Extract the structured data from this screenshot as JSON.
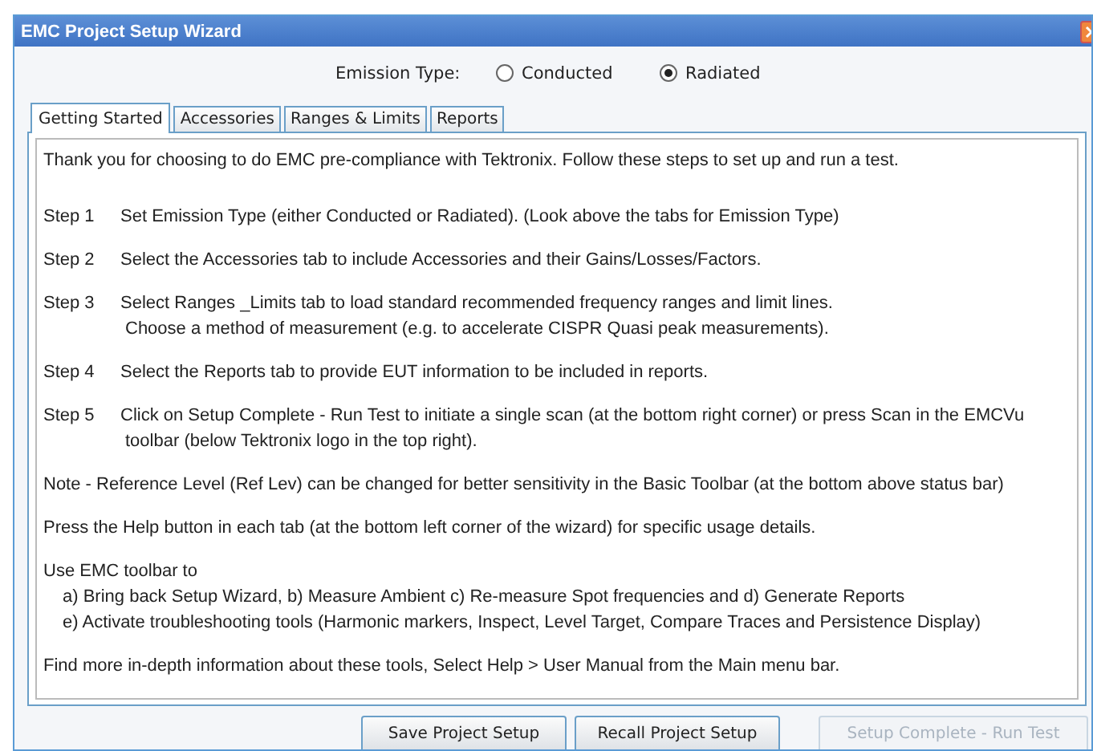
{
  "window": {
    "title": "EMC Project Setup Wizard"
  },
  "emission_type": {
    "label": "Emission Type:",
    "options": [
      {
        "label": "Conducted",
        "selected": false
      },
      {
        "label": "Radiated",
        "selected": true
      }
    ]
  },
  "tabs": [
    {
      "label": "Getting Started",
      "selected": true
    },
    {
      "label": "Accessories",
      "selected": false
    },
    {
      "label": "Ranges & Limits",
      "selected": false
    },
    {
      "label": "Reports",
      "selected": false
    }
  ],
  "content": [
    {
      "kind": "para",
      "lines": [
        "Thank you for choosing to do EMC pre-compliance with Tektronix. Follow these steps to set up and run a test."
      ]
    },
    {
      "kind": "step",
      "label": "Step 1",
      "lines": [
        "Set Emission Type (either Conducted or Radiated). (Look above the tabs for Emission Type)"
      ]
    },
    {
      "kind": "step",
      "label": "Step 2",
      "lines": [
        "Select the Accessories tab to include Accessories and their Gains/Losses/Factors."
      ]
    },
    {
      "kind": "step",
      "label": "Step 3",
      "lines": [
        "Select Ranges _Limits tab to load standard recommended frequency ranges and limit lines.",
        "Choose a method of measurement (e.g. to accelerate CISPR Quasi peak measurements)."
      ]
    },
    {
      "kind": "step",
      "label": "Step 4",
      "lines": [
        "Select the Reports tab to provide EUT information to be included in reports."
      ]
    },
    {
      "kind": "step",
      "label": "Step 5",
      "lines": [
        "Click on Setup Complete - Run Test to initiate a single scan (at the bottom right corner) or press Scan in the EMCVu",
        "toolbar (below Tektronix logo in the top right)."
      ]
    },
    {
      "kind": "para",
      "lines": [
        "Note - Reference Level (Ref Lev) can be changed for better sensitivity in the Basic Toolbar (at the bottom above status bar)"
      ]
    },
    {
      "kind": "para",
      "lines": [
        "Press the Help button in each tab (at the bottom left corner of the wizard) for specific usage details."
      ]
    },
    {
      "kind": "list",
      "lines": [
        "Use EMC toolbar to",
        "a) Bring back Setup Wizard, b) Measure Ambient c) Re-measure Spot frequencies and d) Generate Reports",
        "e) Activate troubleshooting tools (Harmonic markers, Inspect, Level Target, Compare Traces and Persistence Display)"
      ]
    },
    {
      "kind": "para",
      "lines": [
        "Find more in-depth information about these tools, Select Help > User Manual from the Main menu bar."
      ]
    }
  ],
  "buttons": [
    {
      "label": "Save Project Setup",
      "disabled": false
    },
    {
      "label": "Recall Project Setup",
      "disabled": false
    },
    {
      "label": "Setup Complete - Run Test",
      "disabled": true
    }
  ]
}
